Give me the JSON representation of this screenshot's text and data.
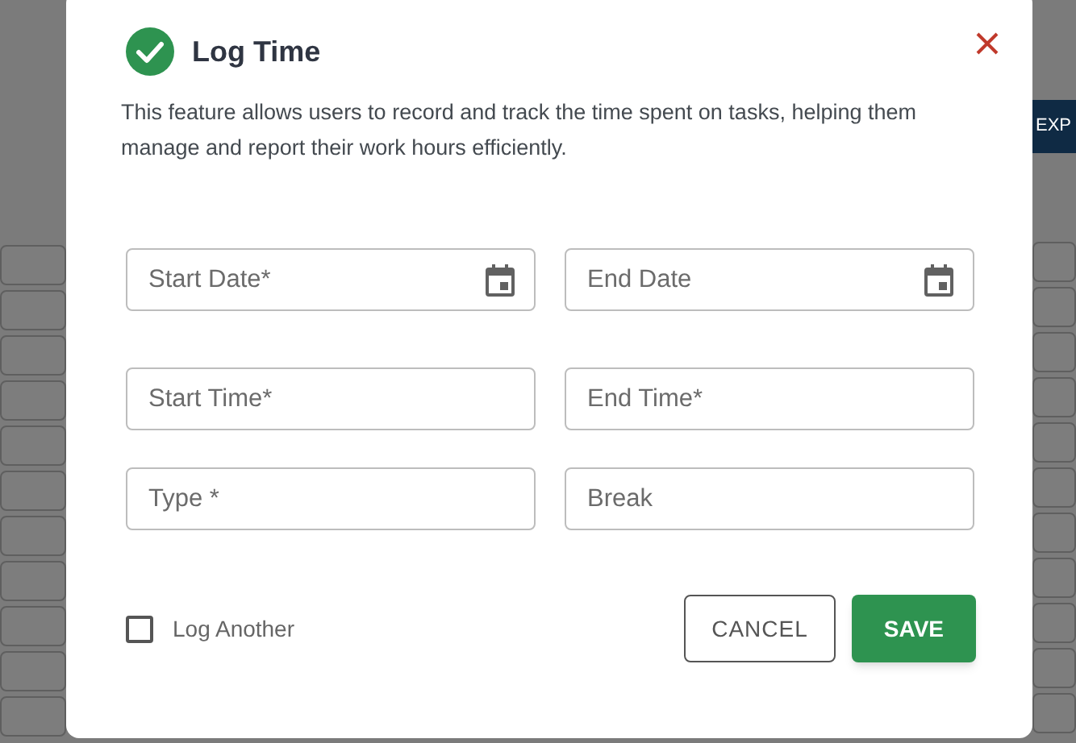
{
  "background": {
    "button_label": "EXP"
  },
  "dialog": {
    "title": "Log Time",
    "description": "This feature allows users to record and track the time spent on tasks, helping them manage and report their work hours efficiently.",
    "fields": [
      {
        "kind": "date",
        "placeholder": "Start Date*"
      },
      {
        "kind": "date",
        "placeholder": "End Date"
      },
      {
        "kind": "text",
        "placeholder": "Start Time*"
      },
      {
        "kind": "text",
        "placeholder": "End Time*"
      },
      {
        "kind": "text",
        "placeholder": "Type *"
      },
      {
        "kind": "text",
        "placeholder": "Break"
      }
    ],
    "log_another": {
      "label": "Log Another",
      "checked": false
    },
    "buttons": [
      {
        "kind": "outline",
        "label": "CANCEL"
      },
      {
        "kind": "filled",
        "label": "SAVE"
      }
    ]
  }
}
